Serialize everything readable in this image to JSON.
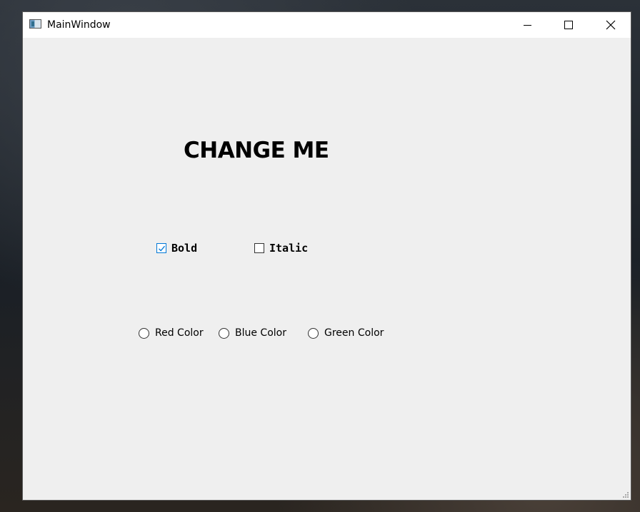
{
  "window": {
    "title": "MainWindow",
    "icon": "app-window-icon"
  },
  "titlebar_buttons": {
    "minimize": "minimize-icon",
    "maximize": "maximize-icon",
    "close": "close-icon"
  },
  "main": {
    "headline": "CHANGE ME",
    "checkboxes": [
      {
        "label": "Bold",
        "checked": true
      },
      {
        "label": "Italic",
        "checked": false
      }
    ],
    "radios": [
      {
        "label": "Red Color",
        "selected": false
      },
      {
        "label": "Blue Color",
        "selected": false
      },
      {
        "label": "Green Color",
        "selected": false
      }
    ]
  },
  "colors": {
    "accent": "#0078d7",
    "client_bg": "#efefef",
    "titlebar_bg": "#ffffff"
  }
}
